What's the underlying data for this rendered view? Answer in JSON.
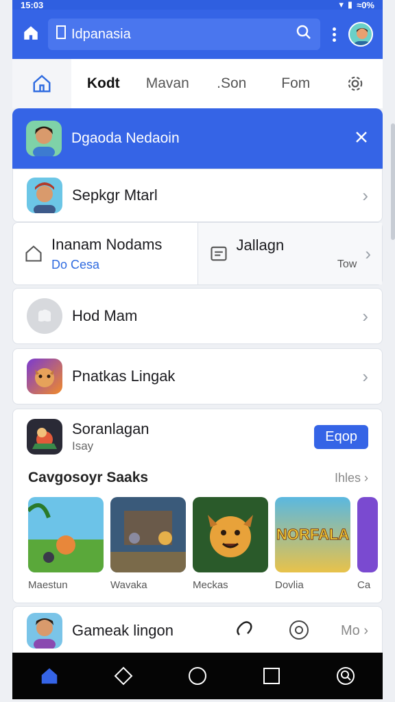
{
  "status": {
    "time": "15:03",
    "right": "≈0%"
  },
  "appbar": {
    "search_value": "Idpanasia"
  },
  "tabs": [
    {
      "label": "Kodt"
    },
    {
      "label": "Mavan"
    },
    {
      "label": ".Son"
    },
    {
      "label": "Fom"
    }
  ],
  "banner": {
    "title": "Dgaoda Nedaoin"
  },
  "rows": {
    "row1": {
      "label": "Sepkgr Mtarl"
    },
    "split_left": {
      "title": "Inanam Nodams",
      "sub": "Do Cesa"
    },
    "split_right": {
      "title": "Jallagn",
      "sub": "Tow"
    },
    "row3": {
      "label": "Hod Mam"
    },
    "row4": {
      "label": "Pnatkas Lingak"
    }
  },
  "featured": {
    "name": "Soranlagan",
    "sub": "Isay",
    "button": "Eqop",
    "section_title": "Cavgosoyr Saaks",
    "more": "Ihles",
    "games": [
      {
        "name": "Maestun"
      },
      {
        "name": "Wavaka"
      },
      {
        "name": "Meckas"
      },
      {
        "name": "Dovlia",
        "art_text": "NORFALA"
      },
      {
        "name": "Ca"
      }
    ]
  },
  "bottom_card": {
    "label": "Gameak lingon",
    "more": "Mo"
  },
  "colors": {
    "primary": "#3564e6",
    "accent_link": "#2f6be0"
  }
}
